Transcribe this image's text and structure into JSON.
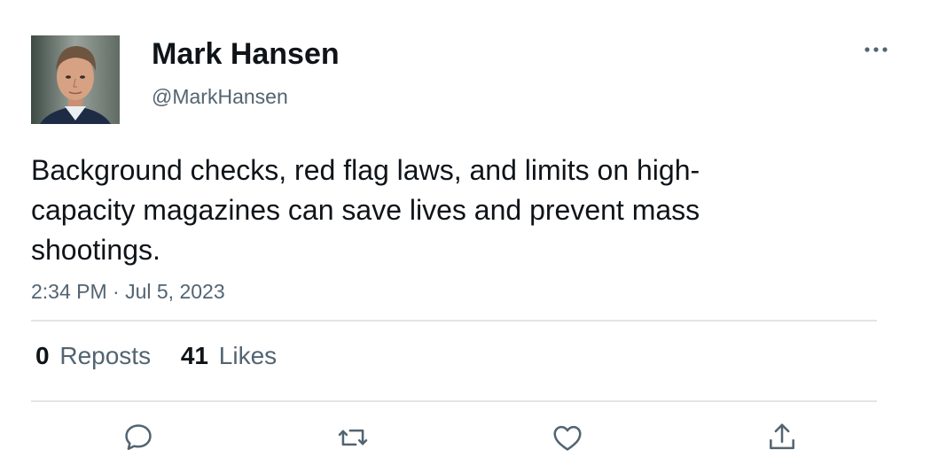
{
  "user": {
    "display_name": "Mark Hansen",
    "handle": "@MarkHansen"
  },
  "tweet": {
    "text_lines": [
      "Background checks, red flag laws, and limits on high-",
      "capacity magazines can save lives and prevent mass",
      "shootings."
    ],
    "timestamp": "2:34 PM · Jul 5, 2023"
  },
  "stats": {
    "reposts_count": "0",
    "reposts_label": "Reposts",
    "likes_count": "41",
    "likes_label": "Likes"
  },
  "actions": [
    {
      "icon": "reply-icon"
    },
    {
      "icon": "repost-icon"
    },
    {
      "icon": "like-icon"
    },
    {
      "icon": "share-icon"
    }
  ],
  "colors": {
    "text": "#0f1419",
    "secondary": "#536471",
    "divider": "#e1e4e8"
  }
}
